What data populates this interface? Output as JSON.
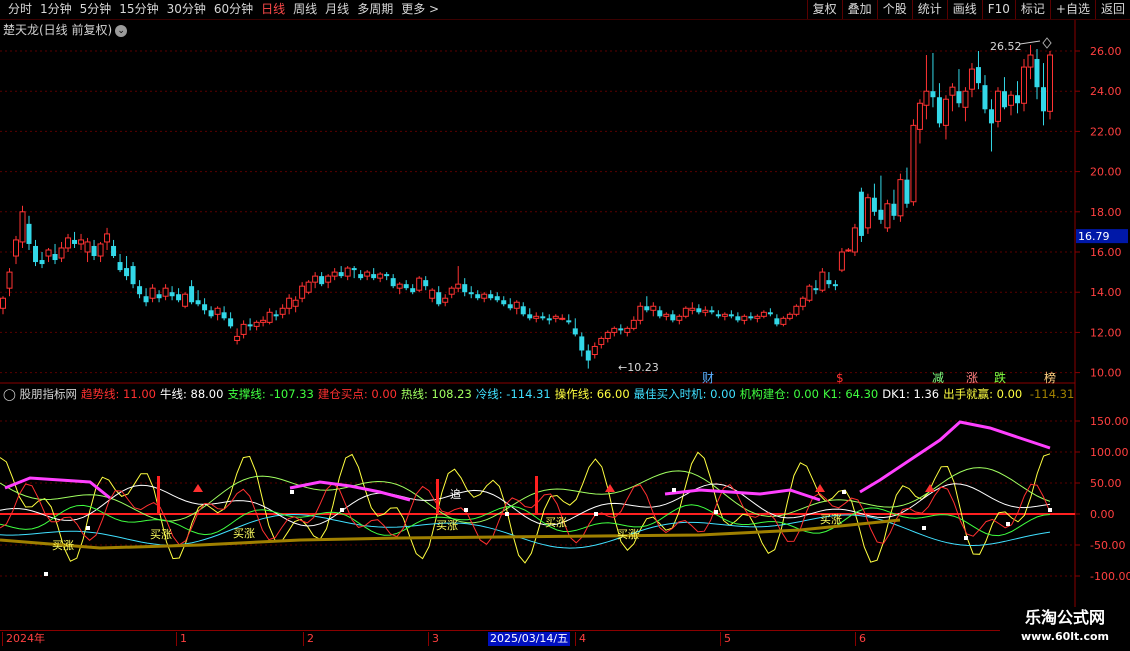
{
  "toolbar": {
    "periods": [
      "分时",
      "1分钟",
      "5分钟",
      "15分钟",
      "30分钟",
      "60分钟",
      "日线",
      "周线",
      "月线",
      "多周期",
      "更多"
    ],
    "more_arrow": ">",
    "active_period": "日线",
    "tools": [
      "复权",
      "叠加",
      "个股",
      "统计",
      "画线",
      "F10",
      "标记",
      "+自选",
      "返回"
    ]
  },
  "chart": {
    "title": "楚天龙(日线 前复权)",
    "price_ticks": [
      "26.00",
      "24.00",
      "22.00",
      "20.00",
      "18.00",
      "16.00",
      "14.00",
      "12.00",
      "10.00"
    ],
    "current_price": "16.79",
    "high_label": "26.52",
    "low_label": "10.23",
    "event_markers": [
      "财",
      "$",
      "减",
      "涨",
      "跌",
      "榜"
    ]
  },
  "indicator": {
    "name": "股朋指标网",
    "fields": [
      {
        "label": "趋势线:",
        "value": "11.00",
        "color": "#ff3030"
      },
      {
        "label": "牛线:",
        "value": "88.00",
        "color": "#ffffff"
      },
      {
        "label": "支撑线:",
        "value": "-107.33",
        "color": "#40ff40"
      },
      {
        "label": "建仓买点:",
        "value": "0.00",
        "color": "#ff3030"
      },
      {
        "label": "热线:",
        "value": "108.23",
        "color": "#a0ff60"
      },
      {
        "label": "冷线:",
        "value": "-114.31",
        "color": "#40e0ff"
      },
      {
        "label": "操作线:",
        "value": "66.00",
        "color": "#ffff40"
      },
      {
        "label": "最佳买入时机:",
        "value": "0.00",
        "color": "#40e0ff"
      },
      {
        "label": "机构建仓:",
        "value": "0.00",
        "color": "#40ff40"
      },
      {
        "label": "K1:",
        "value": "64.30",
        "color": "#40ff40"
      },
      {
        "label": "DK1:",
        "value": "1.36",
        "color": "#ffffff"
      },
      {
        "label": "出手就赢:",
        "value": "0.00",
        "color": "#ffff40"
      },
      {
        "label": "",
        "value": "-114.31",
        "color": "#a08000"
      }
    ],
    "ticks": [
      "150.00",
      "100.00",
      "50.00",
      "0.00",
      "-50.00",
      "-100.00"
    ],
    "buy_signal_text": "买涨",
    "chase_text": "追"
  },
  "dates": {
    "ticks": [
      "2024年",
      "1",
      "2",
      "3",
      "4",
      "5",
      "6"
    ],
    "cursor": "2025/03/14/五"
  },
  "watermark": {
    "line1": "乐淘公式网",
    "line2": "www.60lt.com"
  }
}
